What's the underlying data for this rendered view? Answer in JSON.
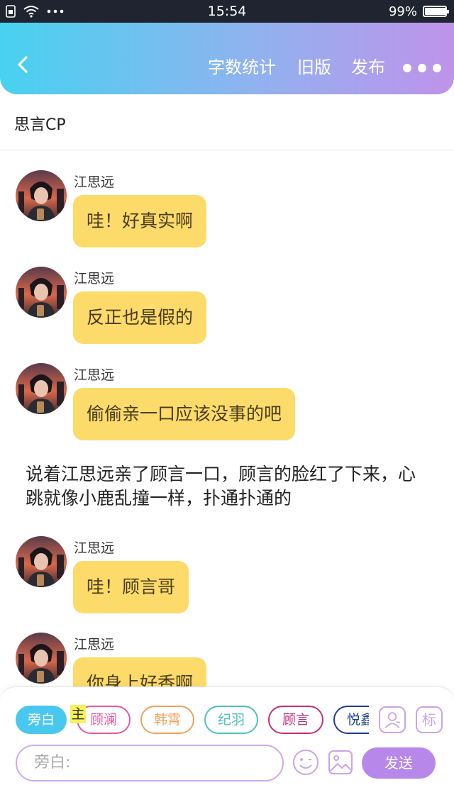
{
  "status_bar": {
    "time": "15:54",
    "battery": "99%",
    "battery_level": 0.99
  },
  "header": {
    "word_count": "字数统计",
    "old_version": "旧版",
    "publish": "发布"
  },
  "story_title": "思言CP",
  "messages": [
    {
      "speaker": "江思远",
      "text": "哇！好真实啊"
    },
    {
      "speaker": "江思远",
      "text": "反正也是假的"
    },
    {
      "speaker": "江思远",
      "text": "偷偷亲一口应该没事的吧"
    },
    {
      "speaker": "江思远",
      "text": "哇！顾言哥"
    },
    {
      "speaker": "江思远",
      "text": "你身上好香啊"
    }
  ],
  "narration": "说着江思远亲了顾言一口，顾言的脸红了下来，心跳就像小鹿乱撞一样，扑通扑通的",
  "toolbar": {
    "chips": [
      {
        "label": "旁白",
        "color": "#49c8ef"
      },
      {
        "label": "顾澜",
        "color": "#e75a9b"
      },
      {
        "label": "韩霄",
        "color": "#f0a25c"
      },
      {
        "label": "纪羽",
        "color": "#4fbfbf"
      },
      {
        "label": "顾言",
        "color": "#c2307a"
      },
      {
        "label": "悦鑫",
        "color": "#1e3f8f"
      }
    ],
    "main_tag": "主",
    "mark_label": "标",
    "input_placeholder": "旁白:",
    "send_label": "发送"
  },
  "colors": {
    "bubble": "#fddb6b",
    "accent": "#b788ea",
    "header_start": "#47d2f0",
    "header_end": "#bf93ea"
  }
}
